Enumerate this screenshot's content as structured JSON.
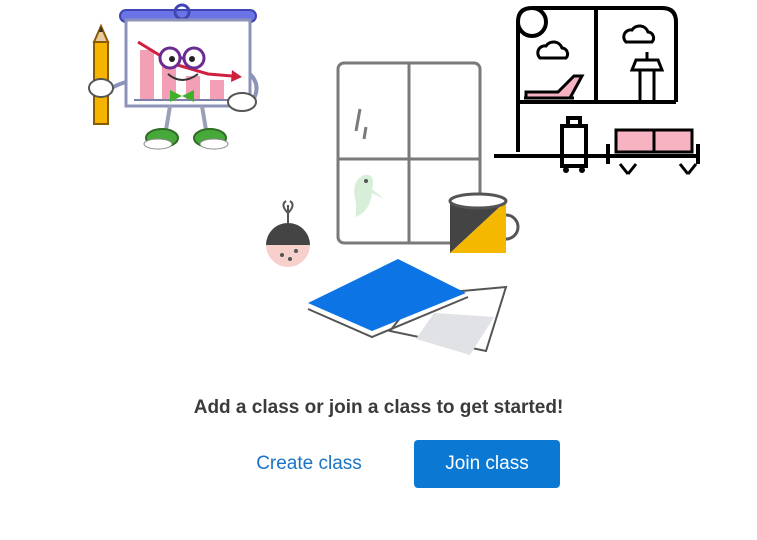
{
  "empty_state": {
    "prompt": "Add a class or join a class to get started!"
  },
  "actions": {
    "create_label": "Create class",
    "join_label": "Join class"
  },
  "colors": {
    "primary": "#0b78d4",
    "link": "#1a73c4",
    "text": "#3b3b3b"
  }
}
